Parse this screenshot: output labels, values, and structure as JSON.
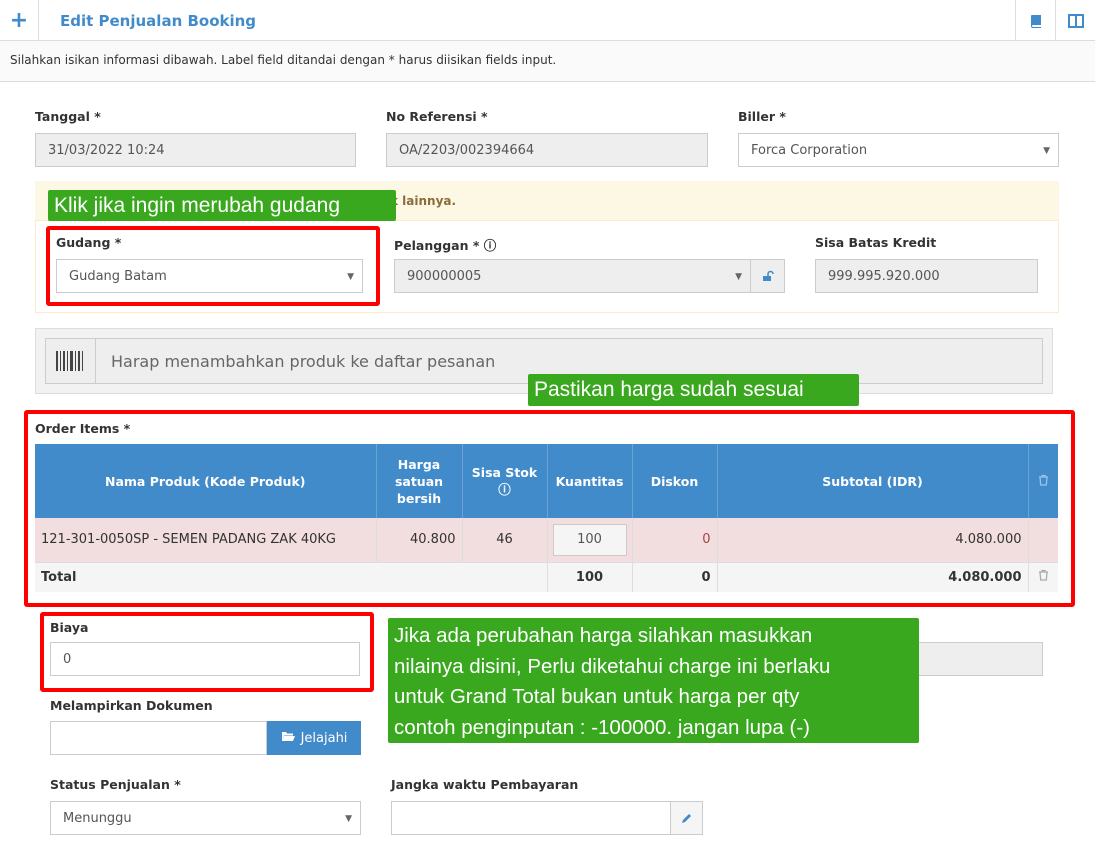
{
  "header": {
    "plus_icon": "+",
    "title": "Edit Penjualan Booking",
    "book_icon": "book-icon",
    "columns_icon": "columns-icon"
  },
  "subbar_text": "Silahkan isikan informasi dibawah. Label field ditandai dengan * harus diisikan fields input.",
  "form": {
    "tanggal_label": "Tanggal *",
    "tanggal_value": "31/03/2022 10:24",
    "no_ref_label": "No Referensi *",
    "no_ref_value": "OA/2203/002394664",
    "biller_label": "Biller *",
    "biller_value": "Forca Corporation",
    "warning_text": "k lainnya.",
    "gudang_label": "Gudang *",
    "gudang_value": "Gudang Batam",
    "pelanggan_label": "Pelanggan *",
    "pelanggan_value": "900000005",
    "sisa_label": "Sisa Batas Kredit",
    "sisa_value": "999.995.920.000",
    "search_placeholder": "Harap menambahkan produk ke daftar pesanan"
  },
  "order": {
    "label": "Order Items *",
    "columns": [
      "Nama Produk (Kode Produk)",
      "Harga satuan bersih",
      "Sisa Stok",
      "Kuantitas",
      "Diskon",
      "Subtotal (IDR)"
    ],
    "rows": [
      {
        "produk": "121-301-0050SP - SEMEN PADANG ZAK 40KG",
        "harga": "40.800",
        "stok": "46",
        "qty": "100",
        "diskon": "0",
        "subtotal": "4.080.000"
      }
    ],
    "total_label": "Total",
    "total_qty": "100",
    "total_diskon": "0",
    "total_subtotal": "4.080.000"
  },
  "bottom": {
    "biaya_label": "Biaya",
    "biaya_value": "0",
    "lampiran_label": "Melampirkan Dokumen",
    "jelajahi_label": "Jelajahi",
    "status_label": "Status Penjualan *",
    "status_value": "Menunggu",
    "jangka_label": "Jangka waktu Pembayaran"
  },
  "callouts": {
    "gudang": "Klik jika ingin merubah gudang",
    "harga": "Pastikan harga sudah sesuai",
    "biaya_line1": "Jika ada perubahan harga silahkan masukkan",
    "biaya_line2": "nilainya disini, Perlu diketahui charge ini berlaku",
    "biaya_line3": "untuk Grand Total bukan untuk harga per qty",
    "biaya_line4": "contoh penginputan : -100000. jangan lupa (-)"
  },
  "colors": {
    "accent": "#428bca",
    "callout": "#39a81f",
    "highlight": "#ff0000"
  }
}
